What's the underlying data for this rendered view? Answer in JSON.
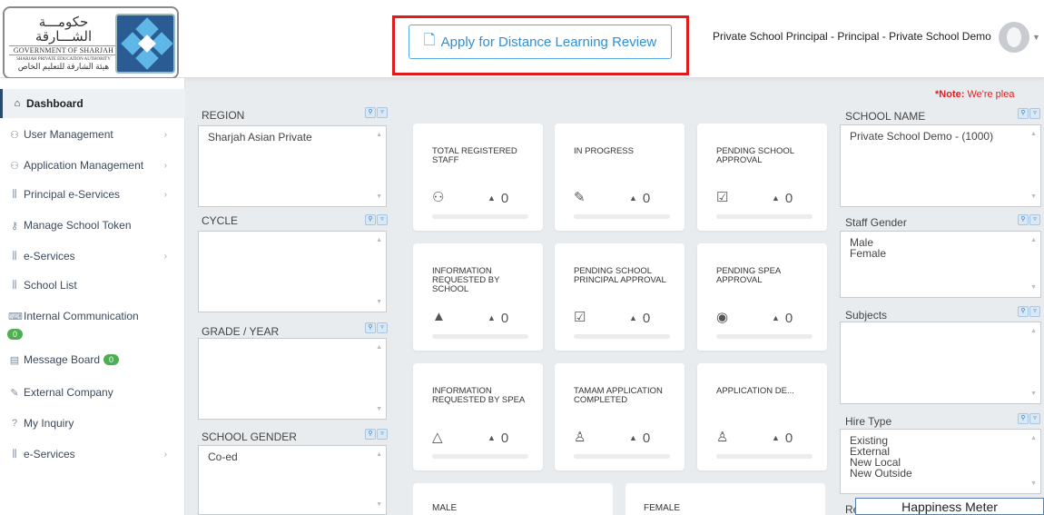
{
  "header": {
    "logo_ar_top": "حكومـــة الشـــارقة",
    "logo_en_top": "GOVERNMENT OF SHARJAH",
    "logo_en_small": "SHARJAH PRIVATE EDUCATION AUTHORITY",
    "logo_ar_bottom": "هيئة الشارقة للتعليم الخاص",
    "apply_label": "Apply for Distance Learning Review",
    "user_label": "Private School Principal - Principal - Private School Demo"
  },
  "sidebar": {
    "items": [
      {
        "label": "Dashboard",
        "icon": "home-icon",
        "glyph": "⌂",
        "active": true,
        "arrow": false
      },
      {
        "label": "User Management",
        "icon": "users-icon",
        "glyph": "⚇",
        "arrow": true
      },
      {
        "label": "Application Management",
        "icon": "users-icon",
        "glyph": "⚇",
        "arrow": true
      },
      {
        "label": "Principal e-Services",
        "icon": "library-icon",
        "glyph": "⫼",
        "arrow": true
      },
      {
        "label": "Manage School Token",
        "icon": "key-icon",
        "glyph": "⚷",
        "arrow": false
      },
      {
        "label": "e-Services",
        "icon": "library-icon",
        "glyph": "⫼",
        "arrow": true
      },
      {
        "label": "School List",
        "icon": "library-icon",
        "glyph": "⫼",
        "arrow": false
      },
      {
        "label": "Internal Communication",
        "icon": "chat-icon",
        "glyph": "⌨",
        "arrow": false
      },
      {
        "label": "Message Board",
        "icon": "message-icon",
        "glyph": "▤",
        "arrow": false
      },
      {
        "label": "External Company",
        "icon": "edit-icon",
        "glyph": "✎",
        "arrow": false
      },
      {
        "label": "My Inquiry",
        "icon": "question-icon",
        "glyph": "?",
        "arrow": false
      },
      {
        "label": "e-Services",
        "icon": "library-icon",
        "glyph": "⫼",
        "arrow": true
      }
    ],
    "internal_badge": "0",
    "message_badge": "0"
  },
  "filters_left": {
    "region_label": "REGION",
    "region_value": "Sharjah Asian Private",
    "cycle_label": "CYCLE",
    "grade_label": "GRADE / YEAR",
    "gender_label": "SCHOOL GENDER",
    "gender_value": "Co-ed"
  },
  "filters_right": {
    "school_label": "SCHOOL NAME",
    "school_value": "Private School Demo - (1000)",
    "staff_gender_label": "Staff Gender",
    "staff_gender_values": [
      "Male",
      "Female"
    ],
    "subjects_label": "Subjects",
    "hire_label": "Hire Type",
    "hire_values": [
      "Existing",
      "External",
      "New Local",
      "New Outside"
    ],
    "re_fragment": "Re"
  },
  "note": {
    "strong": "*Note:",
    "text": " We're plea"
  },
  "cards": [
    {
      "title": "TOTAL REGISTERED STAFF",
      "icon": "staff-icon",
      "glyph": "⚇",
      "count": "0"
    },
    {
      "title": "IN PROGRESS",
      "icon": "edit-icon",
      "glyph": "✎",
      "count": "0"
    },
    {
      "title": "PENDING SCHOOL APPROVAL",
      "icon": "clipboard-check-icon",
      "glyph": "☑",
      "count": "0"
    },
    {
      "title": "INFORMATION REQUESTED BY SCHOOL",
      "icon": "warning-icon",
      "glyph": "▲",
      "count": "0"
    },
    {
      "title": "PENDING SCHOOL PRINCIPAL APPROVAL",
      "icon": "clipboard-check-icon",
      "glyph": "☑",
      "count": "0"
    },
    {
      "title": "PENDING SPEA APPROVAL",
      "icon": "eye-icon",
      "glyph": "◉",
      "count": "0"
    },
    {
      "title": "INFORMATION REQUESTED BY SPEA",
      "icon": "warning-outline-icon",
      "glyph": "△",
      "count": "0"
    },
    {
      "title": "TAMAM APPLICATION COMPLETED",
      "icon": "user-outline-icon",
      "glyph": "♙",
      "count": "0"
    },
    {
      "title": "APPLICATION DE...",
      "icon": "user-remove-icon",
      "glyph": "♙",
      "count": "0"
    }
  ],
  "wide_cards": {
    "male": "MALE",
    "female": "FEMALE"
  },
  "happiness": "Happiness Meter",
  "colors": {
    "accent": "#2f8fd8",
    "highlight_frame": "#e01b1b",
    "badge": "#4caf50",
    "nav_active": "#2b4b6e"
  }
}
